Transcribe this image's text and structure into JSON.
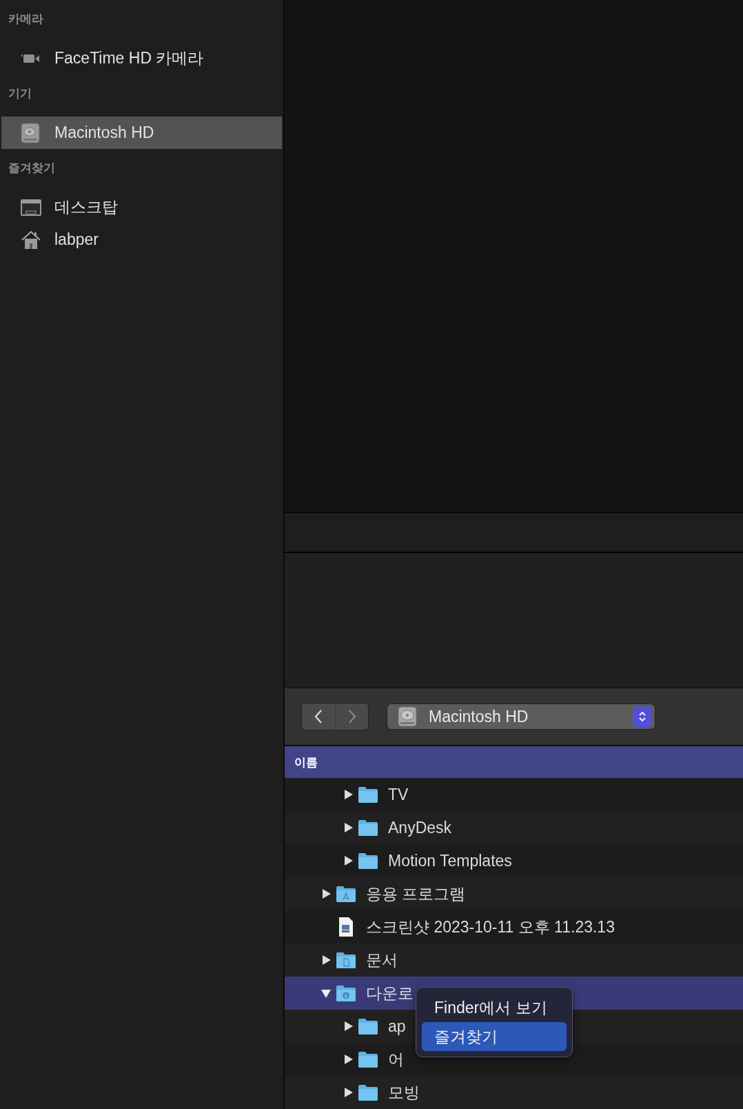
{
  "sidebar": {
    "sections": [
      {
        "heading": "카메라",
        "items": [
          {
            "label": "FaceTime HD 카메라",
            "kind": "camera",
            "selected": false
          }
        ]
      },
      {
        "heading": "기기",
        "items": [
          {
            "label": "Macintosh HD",
            "kind": "disk",
            "selected": true
          }
        ]
      },
      {
        "heading": "즐겨찾기",
        "items": [
          {
            "label": "데스크탑",
            "kind": "desktop",
            "selected": false
          },
          {
            "label": "labper",
            "kind": "home",
            "selected": false
          }
        ]
      }
    ]
  },
  "toolbar": {
    "location": "Macintosh HD"
  },
  "list": {
    "column": "이름"
  },
  "tree": {
    "hidden_parent_children": [
      {
        "name": "TV",
        "kind": "folder",
        "expanded": false,
        "selected": false
      },
      {
        "name": "AnyDesk",
        "kind": "folder",
        "expanded": false,
        "selected": false
      },
      {
        "name": "Motion Templates",
        "kind": "folder",
        "expanded": false,
        "selected": false
      }
    ],
    "items": [
      {
        "name": "응용 프로그램",
        "kind": "apps",
        "expanded": false,
        "selected": false
      },
      {
        "name": "스크린샷 2023-10-11 오후 11.23.13",
        "kind": "file",
        "selected": false
      },
      {
        "name": "문서",
        "kind": "docs",
        "expanded": false,
        "selected": false
      },
      {
        "name": "다운로",
        "kind": "downloads",
        "expanded": true,
        "selected": true,
        "children": [
          {
            "name": "ap",
            "kind": "folder",
            "expanded": false,
            "selected": false
          },
          {
            "name": "어",
            "kind": "folder",
            "expanded": false,
            "selected": false
          },
          {
            "name": "모빙",
            "kind": "folder",
            "expanded": false,
            "selected": false
          }
        ]
      }
    ]
  },
  "context_menu": {
    "items": [
      {
        "label": "Finder에서 보기",
        "selected": false
      },
      {
        "label": "즐겨찾기",
        "selected": true
      }
    ]
  }
}
